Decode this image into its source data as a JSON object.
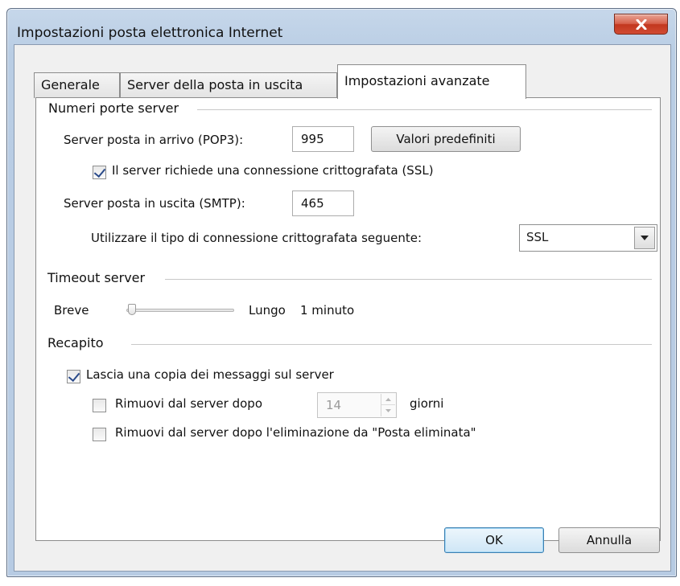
{
  "window": {
    "title": "Impostazioni posta elettronica Internet"
  },
  "tabs": [
    {
      "label": "Generale",
      "active": false
    },
    {
      "label": "Server della posta in uscita",
      "active": false
    },
    {
      "label": "Impostazioni avanzate",
      "active": true
    }
  ],
  "server_ports": {
    "group_label": "Numeri porte server",
    "incoming_label": "Server posta in arrivo (POP3):",
    "incoming_value": "995",
    "defaults_button": "Valori predefiniti",
    "ssl_checkbox_label": "Il server richiede una connessione crittografata (SSL)",
    "ssl_checked": true,
    "outgoing_label": "Server posta in uscita (SMTP):",
    "outgoing_value": "465",
    "encryption_label": "Utilizzare il tipo di connessione crittografata seguente:",
    "encryption_value": "SSL"
  },
  "timeout": {
    "group_label": "Timeout server",
    "short_label": "Breve",
    "long_label": "Lungo",
    "value_label": "1 minuto",
    "slider_level": 0.05
  },
  "delivery": {
    "group_label": "Recapito",
    "leave_copy_label": "Lascia una copia dei messaggi sul server",
    "leave_copy_checked": true,
    "remove_after_label": "Rimuovi dal server dopo",
    "remove_after_checked": false,
    "days_value": "14",
    "days_label": "giorni",
    "remove_deleted_label": "Rimuovi dal server dopo l'eliminazione da \"Posta eliminata\"",
    "remove_deleted_checked": false
  },
  "footer": {
    "ok_label": "OK",
    "cancel_label": "Annulla"
  },
  "colors": {
    "close_button": "#c2371e",
    "primary_button_border": "#3c7fb1",
    "checkmark": "#2a4a8a"
  }
}
